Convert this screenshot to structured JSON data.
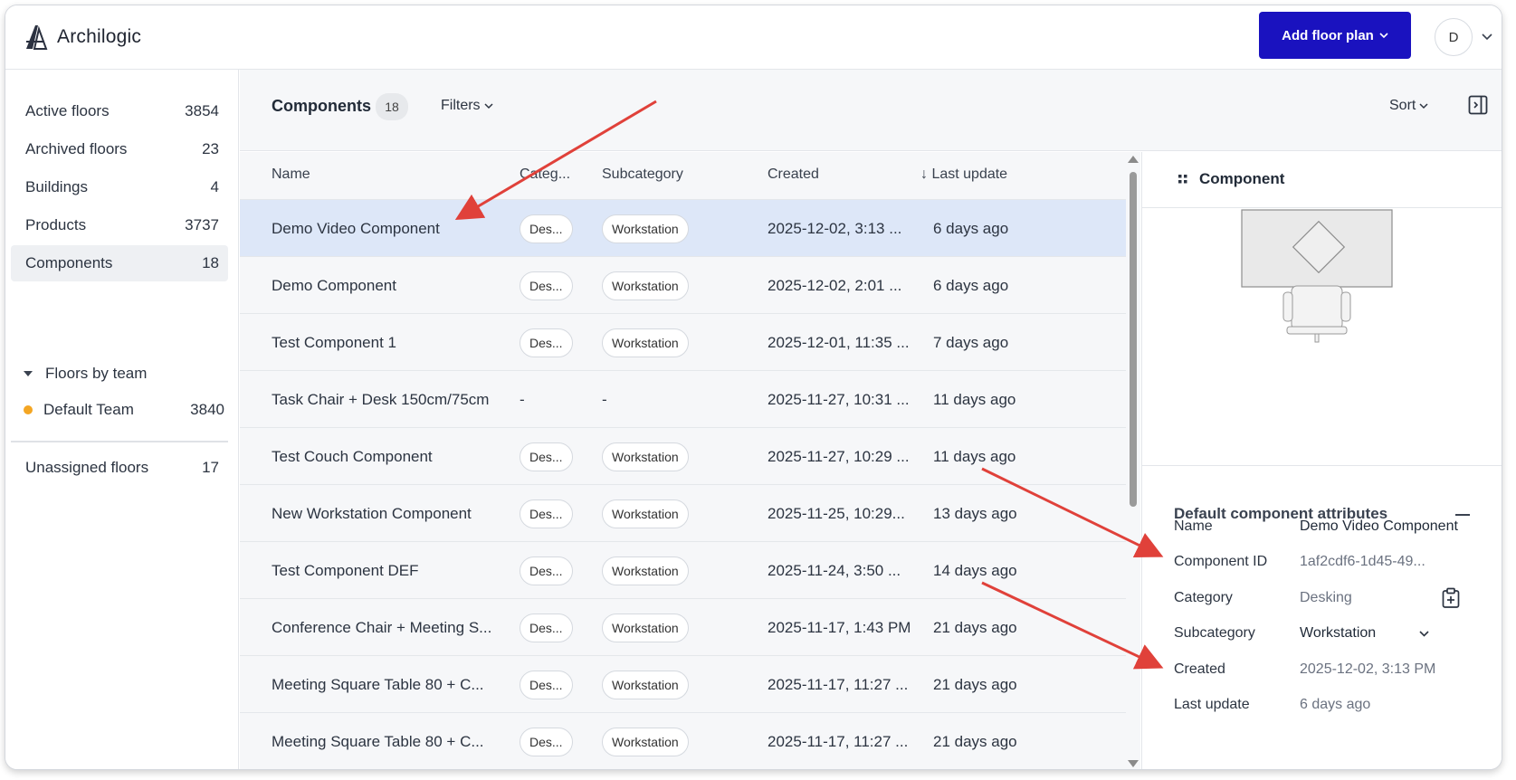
{
  "app": {
    "name": "Archilogic"
  },
  "header": {
    "add_button_label": "Add floor plan",
    "avatar_initial": "D"
  },
  "sidebar": {
    "items": [
      {
        "label": "Active floors",
        "count": "3854"
      },
      {
        "label": "Archived floors",
        "count": "23"
      },
      {
        "label": "Buildings",
        "count": "4"
      },
      {
        "label": "Products",
        "count": "3737"
      },
      {
        "label": "Components",
        "count": "18",
        "active": true
      }
    ],
    "team_section_label": "Floors by team",
    "teams": [
      {
        "label": "Default Team",
        "count": "3840",
        "color": "#f4a623"
      }
    ],
    "unassigned": {
      "label": "Unassigned floors",
      "count": "17"
    }
  },
  "toolbar": {
    "title": "Components",
    "count": "18",
    "filters_label": "Filters",
    "sort_label": "Sort"
  },
  "table": {
    "columns": [
      "Name",
      "Categ...",
      "Subcategory",
      "Created",
      "Last update"
    ],
    "sort_indicator": "↓",
    "rows": [
      {
        "name": "Demo Video Component",
        "category": "Des...",
        "subcategory": "Workstation",
        "created": "2025-12-02, 3:13 ...",
        "updated": "6 days ago"
      },
      {
        "name": "Demo Component",
        "category": "Des...",
        "subcategory": "Workstation",
        "created": "2025-12-02, 2:01 ...",
        "updated": "6 days ago"
      },
      {
        "name": "Test Component 1",
        "category": "Des...",
        "subcategory": "Workstation",
        "created": "2025-12-01, 11:35 ...",
        "updated": "7 days ago"
      },
      {
        "name": "Task Chair + Desk 150cm/75cm",
        "category": "-",
        "subcategory": "-",
        "created": "2025-11-27, 10:31 ...",
        "updated": "11 days ago"
      },
      {
        "name": "Test Couch Component",
        "category": "Des...",
        "subcategory": "Workstation",
        "created": "2025-11-27, 10:29 ...",
        "updated": "11 days ago"
      },
      {
        "name": "New Workstation Component",
        "category": "Des...",
        "subcategory": "Workstation",
        "created": "2025-11-25, 10:29...",
        "updated": "13 days ago"
      },
      {
        "name": "Test Component DEF",
        "category": "Des...",
        "subcategory": "Workstation",
        "created": "2025-11-24, 3:50 ...",
        "updated": "14 days ago"
      },
      {
        "name": "Conference Chair + Meeting S...",
        "category": "Des...",
        "subcategory": "Workstation",
        "created": "2025-11-17, 1:43 PM",
        "updated": "21 days ago"
      },
      {
        "name": "Meeting Square Table 80 + C...",
        "category": "Des...",
        "subcategory": "Workstation",
        "created": "2025-11-17, 11:27 ...",
        "updated": "21 days ago"
      },
      {
        "name": "Meeting Square Table 80 + C...",
        "category": "Des...",
        "subcategory": "Workstation",
        "created": "2025-11-17, 11:27 ...",
        "updated": "21 days ago"
      }
    ]
  },
  "panel": {
    "title": "Component",
    "attributes_title": "Default component attributes",
    "attributes": [
      {
        "label": "Name",
        "value": "Demo Video Component"
      },
      {
        "label": "Component ID",
        "value": "1af2cdf6-1d45-49..."
      },
      {
        "label": "Category",
        "value": "Desking"
      },
      {
        "label": "Subcategory",
        "value": "Workstation"
      },
      {
        "label": "Created",
        "value": "2025-12-02, 3:13 PM"
      },
      {
        "label": "Last update",
        "value": "6 days ago"
      }
    ]
  },
  "colors": {
    "brand": "#1a12bf",
    "selected_row": "#dde7f8",
    "annotation_arrow": "#e0413a",
    "team_dot": "#f4a623"
  }
}
